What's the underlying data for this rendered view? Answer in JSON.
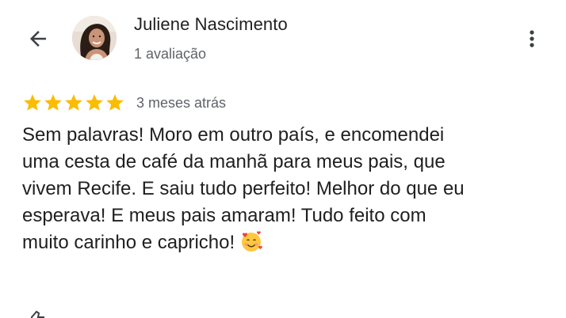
{
  "header": {
    "reviewer_name": "Juliene Nascimento",
    "review_count": "1 avaliação"
  },
  "review": {
    "rating": 5,
    "rating_max": 5,
    "date": "3 meses atrás",
    "lines": [
      "Sem palavras! Moro em outro país, e encomendei",
      "uma cesta de café da manhã para meus pais, que",
      "vivem Recife. E saiu tudo perfeito! Melhor do que eu",
      "esperava! E meus pais amaram! Tudo feito com",
      "muito carinho e capricho!"
    ],
    "emoji": "smiling-face-with-hearts"
  },
  "icons": {
    "back": "arrow-left-icon",
    "menu": "more-vert-icon",
    "star": "star-icon",
    "like": "thumb-up-icon"
  },
  "colors": {
    "star": "#FBBC04",
    "text_primary": "#1f1f1f",
    "text_secondary": "#5f6368"
  }
}
